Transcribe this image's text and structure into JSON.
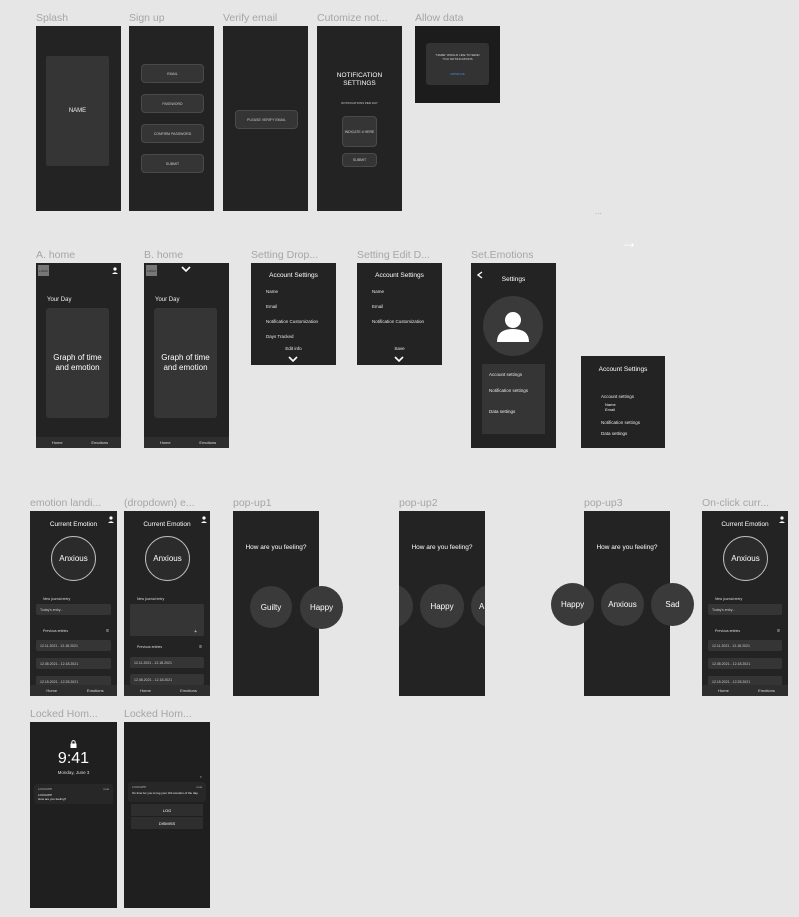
{
  "labels": {
    "splash": "Splash",
    "signup": "Sign up",
    "verify": "Verify email",
    "customize": "Cutomize not...",
    "allow": "Allow data",
    "a_home": "A. home",
    "b_home": "B. home",
    "setting_drop": "Setting Drop...",
    "setting_edit": "Setting Edit D...",
    "set_emotions": "Set.Emotions",
    "emotion_landing": "emotion landi...",
    "dropdown_e": "(dropdown) e...",
    "popup1": "pop-up1",
    "popup2": "pop-up2",
    "popup3": "pop-up3",
    "onclick": "On-click curr...",
    "locked1": "Locked Hom...",
    "locked2": "Locked Hom..."
  },
  "splash": {
    "name": "NAME"
  },
  "signup": {
    "email": "EMAIL",
    "password": "PASSWORD",
    "confirm": "CONFIRM PASSWORD",
    "submit": "SUBMIT"
  },
  "verify": {
    "check": "PLEASE VERIFY EMAIL"
  },
  "customize": {
    "title": "NOTIFICATION SETTINGS",
    "freq": "NOTIFICATIONS PER DAY",
    "input": "INDICATE # HERE",
    "submit": "SUBMIT"
  },
  "allow": {
    "msg": "\"NAME\" WOULD LIKE TO SEND YOU NOTIFICATIONS",
    "approve": "APPROVE"
  },
  "home": {
    "logo": "LOGO",
    "your_day": "Your Day",
    "graph": "Graph of time and emotion",
    "home_tab": "Home",
    "emotions_tab": "Emotions"
  },
  "settings_dropdown": {
    "title": "Account Settings",
    "items": [
      "Name",
      "Email",
      "Notification Customization",
      "Days Tracked"
    ],
    "edit": "Edit info"
  },
  "settings_edit": {
    "title": "Account Settings",
    "items": [
      "Name",
      "Email",
      "Notification Customization"
    ],
    "save": "Save"
  },
  "set_emotions": {
    "title": "Settings",
    "items": [
      "Account settings",
      "Notification settings",
      "Data settings"
    ]
  },
  "account_popup": {
    "title": "Account Settings",
    "account": "Account settings",
    "name": "Name",
    "email": "Email",
    "notif": "Notification settings",
    "data": "Data settings"
  },
  "emotion": {
    "title": "Current Emotion",
    "current": "Anxious",
    "new_entry": "New journal entry",
    "placeholder": "Today's entry...",
    "previous": "Previous entries",
    "entries": [
      "12.11.2021 - 12.18.2021",
      "12.08.2021 - 12.18.2021",
      "12.15.2021 - 12.25.2021"
    ],
    "home_tab": "Home",
    "emotions_tab": "Emotions"
  },
  "popup": {
    "question": "How are you feeling?",
    "p1": [
      "Guilty",
      "Happy"
    ],
    "p2": [
      "Happy",
      "A"
    ],
    "p3": [
      "Happy",
      "Anxious",
      "Sad"
    ]
  },
  "locked": {
    "time": "9:41",
    "date": "Monday, June 3",
    "app": "LOCKAPP",
    "notif_title": "LOCKAPP",
    "notif_body": "How are you feeling?",
    "now": "now",
    "notif2": "It's time for you to log your 3rd emotion of the day.",
    "log": "LOG",
    "dismiss": "DISMISS"
  },
  "dots": "...",
  "arrow": "→"
}
